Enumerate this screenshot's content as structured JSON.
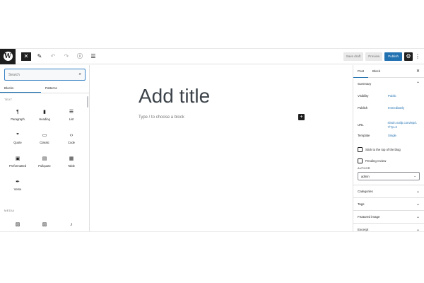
{
  "toolbar": {
    "logo": "W",
    "close_icon": "✕",
    "edit_icon": "✎",
    "undo_icon": "↶",
    "redo_icon": "↷",
    "info_icon": "ⓘ",
    "outline_icon": "☰",
    "save_draft": "Save draft",
    "preview": "Preview",
    "publish": "Publish",
    "settings_icon": "⚙",
    "more_icon": "⋮"
  },
  "inserter": {
    "search_placeholder": "Search",
    "search_icon": "⌕",
    "tabs": [
      {
        "label": "Blocks",
        "active": true
      },
      {
        "label": "Patterns",
        "active": false
      }
    ],
    "categories": [
      {
        "label": "TEXT",
        "blocks": [
          {
            "label": "Paragraph",
            "icon": "¶"
          },
          {
            "label": "Heading",
            "icon": "▮"
          },
          {
            "label": "List",
            "icon": "☰"
          },
          {
            "label": "Quote",
            "icon": "❞"
          },
          {
            "label": "Classic",
            "icon": "▭"
          },
          {
            "label": "Code",
            "icon": "‹›"
          },
          {
            "label": "Preformatted",
            "icon": "▣"
          },
          {
            "label": "Pullquote",
            "icon": "▤"
          },
          {
            "label": "Table",
            "icon": "▦"
          },
          {
            "label": "Verse",
            "icon": "✒"
          }
        ]
      },
      {
        "label": "MEDIA",
        "blocks": [
          {
            "label": "",
            "icon": "▨"
          },
          {
            "label": "",
            "icon": "▨"
          },
          {
            "label": "",
            "icon": "♪"
          }
        ]
      }
    ]
  },
  "canvas": {
    "title_placeholder": "Add title",
    "block_prompt": "Type / to choose a block",
    "add_icon": "+"
  },
  "sidebar": {
    "tabs": [
      {
        "label": "Post",
        "active": true
      },
      {
        "label": "Block",
        "active": false
      }
    ],
    "close_icon": "✕",
    "summary": {
      "title": "Summary",
      "rows": [
        {
          "key": "Visibility",
          "value": "Public"
        },
        {
          "key": "Publish",
          "value": "Immediately"
        },
        {
          "key": "URL",
          "value": "sinsin.nutfp.com/wp/17/?p=3"
        },
        {
          "key": "Template",
          "value": "Single"
        }
      ],
      "checks": [
        {
          "label": "Stick to the top of the blog"
        },
        {
          "label": "Pending review"
        }
      ],
      "author_label": "AUTHOR",
      "author_value": "admin"
    },
    "panels": [
      {
        "title": "Categories"
      },
      {
        "title": "Tags"
      },
      {
        "title": "Featured image"
      },
      {
        "title": "Excerpt"
      }
    ]
  }
}
